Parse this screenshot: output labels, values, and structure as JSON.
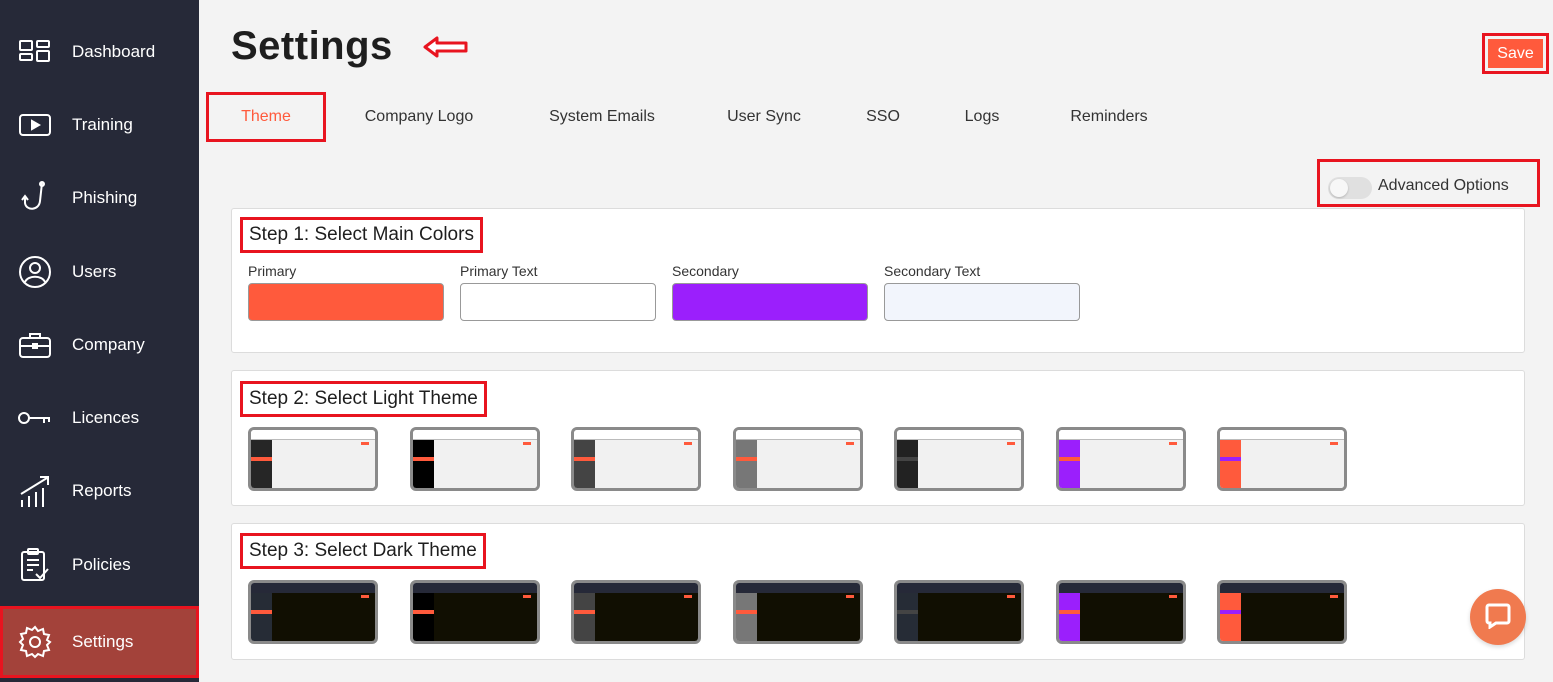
{
  "sidebar": {
    "items": [
      {
        "label": "Dashboard",
        "icon": "dashboard-icon"
      },
      {
        "label": "Training",
        "icon": "play-icon"
      },
      {
        "label": "Phishing",
        "icon": "hook-icon"
      },
      {
        "label": "Users",
        "icon": "user-icon"
      },
      {
        "label": "Company",
        "icon": "briefcase-icon"
      },
      {
        "label": "Licences",
        "icon": "key-icon"
      },
      {
        "label": "Reports",
        "icon": "chart-up-icon"
      },
      {
        "label": "Policies",
        "icon": "clipboard-check-icon"
      },
      {
        "label": "Settings",
        "icon": "gear-icon",
        "active": true
      }
    ]
  },
  "header": {
    "title": "Settings",
    "save_label": "Save"
  },
  "tabs": [
    {
      "label": "Theme",
      "active": true
    },
    {
      "label": "Company Logo"
    },
    {
      "label": "System Emails"
    },
    {
      "label": "User Sync"
    },
    {
      "label": "SSO"
    },
    {
      "label": "Logs"
    },
    {
      "label": "Reminders"
    }
  ],
  "advanced_options": {
    "label": "Advanced Options",
    "enabled": false
  },
  "step1": {
    "title": "Step 1: Select Main Colors",
    "fields": [
      {
        "label": "Primary",
        "color": "#ff5a3c"
      },
      {
        "label": "Primary Text",
        "color": "#ffffff"
      },
      {
        "label": "Secondary",
        "color": "#9b1ffc"
      },
      {
        "label": "Secondary Text",
        "color": "#f2f5fc"
      }
    ]
  },
  "step2": {
    "title": "Step 2: Select Light Theme",
    "themes": [
      {
        "sidebar": "#262626",
        "stripe": "#ff5a3c"
      },
      {
        "sidebar": "#000000",
        "stripe": "#ff5a3c"
      },
      {
        "sidebar": "#444444",
        "stripe": "#ff5a3c"
      },
      {
        "sidebar": "#777777",
        "stripe": "#ff5a3c"
      },
      {
        "sidebar": "#222222",
        "stripe": "#444444"
      },
      {
        "sidebar": "#9b1ffc",
        "stripe": "#ff5a3c"
      },
      {
        "sidebar": "#ff5a3c",
        "stripe": "#9b1ffc"
      }
    ]
  },
  "step3": {
    "title": "Step 3: Select Dark Theme",
    "themes": [
      {
        "sidebar": "#262c36",
        "stripe": "#ff5a3c"
      },
      {
        "sidebar": "#000000",
        "stripe": "#ff5a3c"
      },
      {
        "sidebar": "#444444",
        "stripe": "#ff5a3c"
      },
      {
        "sidebar": "#777777",
        "stripe": "#ff5a3c"
      },
      {
        "sidebar": "#262c36",
        "stripe": "#444444"
      },
      {
        "sidebar": "#9b1ffc",
        "stripe": "#ff5a3c"
      },
      {
        "sidebar": "#ff5a3c",
        "stripe": "#9b1ffc"
      }
    ]
  },
  "colors": {
    "accent": "#ff5a3c",
    "highlight_border": "#e8141f",
    "sidebar_bg": "#262938",
    "light_topbar": "#f1f1f1",
    "light_content": "#f1f1f1",
    "dark_topbar": "#262938",
    "dark_content": "#110f02"
  },
  "chat": {
    "icon": "chat-bubble-icon"
  }
}
